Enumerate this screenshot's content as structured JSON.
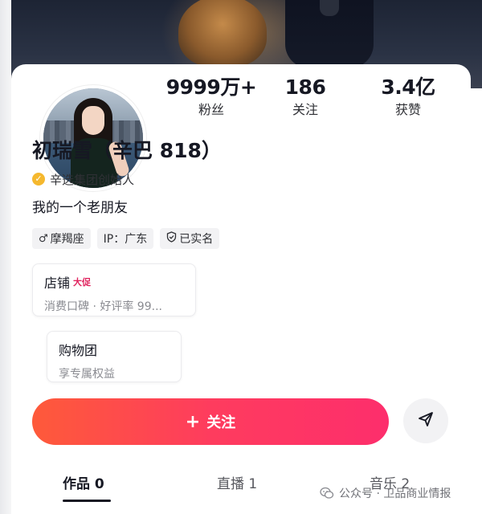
{
  "profile": {
    "stats": [
      {
        "value": "9999万+",
        "label": "粉丝"
      },
      {
        "value": "186",
        "label": "关注"
      },
      {
        "value": "3.4亿",
        "label": "获赞"
      }
    ],
    "name": "初瑞雪（辛巴 818）",
    "verification": "辛选集团创始人",
    "bio": "我的一个老朋友",
    "tags": [
      {
        "icon": "male-icon",
        "glyph": "♂",
        "label": "摩羯座"
      },
      {
        "icon": "",
        "glyph": "",
        "label": "IP：广东"
      },
      {
        "icon": "shield-check-icon",
        "glyph": "",
        "label": "已实名"
      }
    ]
  },
  "shop": {
    "title": "店铺",
    "promo_badge": "大促",
    "subtitle": "消费口碑 · 好评率 99..."
  },
  "group": {
    "title": "购物团",
    "subtitle": "享专属权益"
  },
  "actions": {
    "follow_label": "关注",
    "follow_plus": "+",
    "accent_color": "#fe2c55"
  },
  "tabs": [
    {
      "label": "作品 0",
      "active": true
    },
    {
      "label": "直播 1",
      "active": false
    },
    {
      "label": "音乐 2",
      "active": false
    }
  ],
  "watermark": "公众号 · 卫品商业情报"
}
